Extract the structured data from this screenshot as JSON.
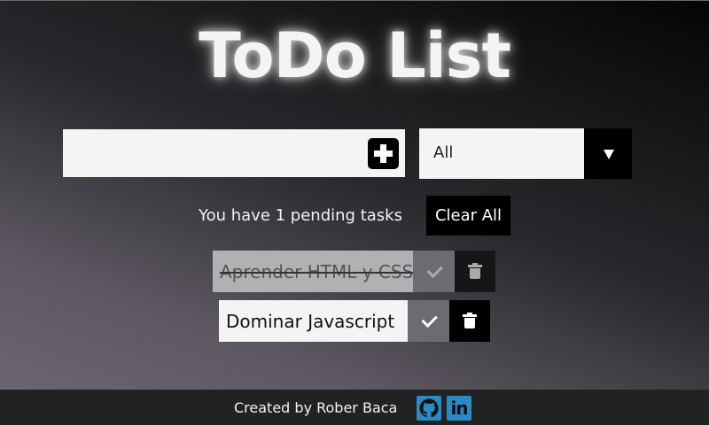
{
  "header": {
    "title": "ToDo List"
  },
  "input": {
    "value": "",
    "placeholder": ""
  },
  "filter": {
    "selected": "All"
  },
  "status": {
    "pending_text": "You have 1 pending tasks",
    "clear_all_label": "Clear All"
  },
  "todos": [
    {
      "text": "Aprender HTML y CSS",
      "completed": true
    },
    {
      "text": "Dominar Javascript",
      "completed": false
    }
  ],
  "footer": {
    "credit": "Created by Rober Baca",
    "social": [
      {
        "icon": "github-icon"
      },
      {
        "icon": "linkedin-icon",
        "glyph": "in"
      }
    ]
  },
  "colors": {
    "accent": "#000000",
    "check_bg": "#6e6a72",
    "completed_bg": "#b1b1b3",
    "social_bg": "#2b89c7",
    "footer_bg": "#222222"
  }
}
